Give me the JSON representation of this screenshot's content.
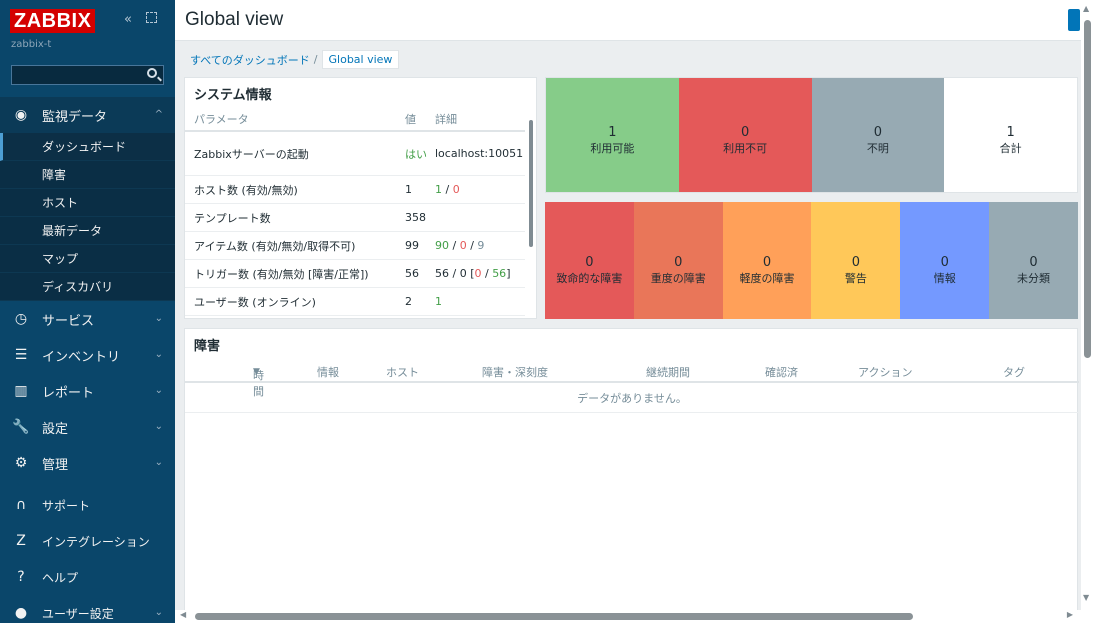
{
  "sidebar": {
    "logo": "ZABBIX",
    "server_name": "zabbix-t",
    "collapse_icon": "«",
    "menu": [
      {
        "label": "監視データ",
        "icon": "eye-icon",
        "glyph": "◉",
        "chevron": "^"
      },
      {
        "label": "サービス",
        "icon": "clock-icon",
        "glyph": "◷",
        "chevron": "⌄"
      },
      {
        "label": "インベントリ",
        "icon": "list-icon",
        "glyph": "☰",
        "chevron": "⌄"
      },
      {
        "label": "レポート",
        "icon": "chart-icon",
        "glyph": "▥",
        "chevron": "⌄"
      },
      {
        "label": "設定",
        "icon": "wrench-icon",
        "glyph": "🔧",
        "chevron": "⌄"
      },
      {
        "label": "管理",
        "icon": "gear-icon",
        "glyph": "⚙",
        "chevron": "⌄"
      }
    ],
    "submenu": [
      "ダッシュボード",
      "障害",
      "ホスト",
      "最新データ",
      "マップ",
      "ディスカバリ"
    ],
    "bottom_menu": [
      {
        "label": "サポート",
        "icon": "headset-icon",
        "glyph": "∩"
      },
      {
        "label": "インテグレーション",
        "icon": "integration-icon",
        "glyph": "Z"
      },
      {
        "label": "ヘルプ",
        "icon": "help-icon",
        "glyph": "?"
      },
      {
        "label": "ユーザー設定",
        "icon": "user-icon",
        "glyph": "●",
        "chevron": "⌄"
      }
    ]
  },
  "header": {
    "title": "Global view"
  },
  "breadcrumb": {
    "parent": "すべてのダッシュボード",
    "separator": "/",
    "current": "Global view"
  },
  "sysinfo": {
    "title": "システム情報",
    "headers": {
      "param": "パラメータ",
      "value": "値",
      "detail": "詳細"
    },
    "rows": [
      {
        "param": "Zabbixサーバーの起動",
        "value": "はい",
        "detail": "localhost:10051"
      },
      {
        "param": "ホスト数 (有効/無効)",
        "value": "1",
        "d1": "1",
        "sep1": " / ",
        "d2": "0"
      },
      {
        "param": "テンプレート数",
        "value": "358"
      },
      {
        "param": "アイテム数 (有効/無効/取得不可)",
        "value": "99",
        "d1": "90",
        "sep1": " / ",
        "d2": "0",
        "sep2": " / ",
        "d3": "9"
      },
      {
        "param": "トリガー数 (有効/無効 [障害/正常])",
        "value": "56",
        "pre": "56 / 0 [",
        "d1": "0",
        "sep1": " / ",
        "d2": "56",
        "post": "]"
      },
      {
        "param": "ユーザー数 (オンライン)",
        "value": "2",
        "d1": "1"
      }
    ]
  },
  "availability": [
    {
      "count": "1",
      "label": "利用可能",
      "color": "#86cc89"
    },
    {
      "count": "0",
      "label": "利用不可",
      "color": "#e45959"
    },
    {
      "count": "0",
      "label": "不明",
      "color": "#97aab3"
    },
    {
      "count": "1",
      "label": "合計",
      "color": "#ffffff"
    }
  ],
  "severities": [
    {
      "count": "0",
      "label": "致命的な障害",
      "color": "#e45959"
    },
    {
      "count": "0",
      "label": "重度の障害",
      "color": "#e97659"
    },
    {
      "count": "0",
      "label": "軽度の障害",
      "color": "#ffa059"
    },
    {
      "count": "0",
      "label": "警告",
      "color": "#ffc859"
    },
    {
      "count": "0",
      "label": "情報",
      "color": "#7499ff"
    },
    {
      "count": "0",
      "label": "未分類",
      "color": "#97aab3"
    }
  ],
  "problems": {
    "title": "障害",
    "columns": [
      "時間",
      "情報",
      "ホスト",
      "障害・深刻度",
      "継続期間",
      "確認済",
      "アクション",
      "タグ"
    ],
    "sort_indicator": "▼",
    "empty": "データがありません。"
  },
  "colors": {
    "sidebar_bg": "#0a466a",
    "accent": "#0275b8",
    "logo_red": "#d40000"
  }
}
